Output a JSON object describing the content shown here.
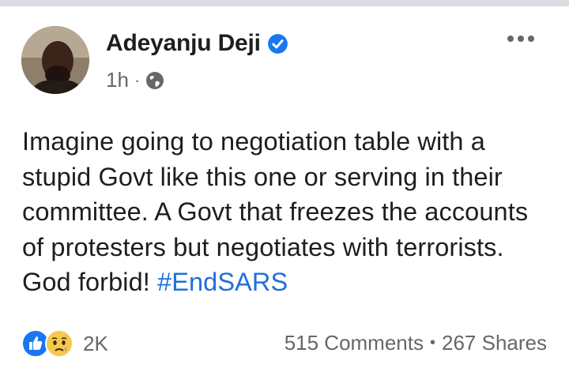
{
  "post": {
    "author": "Adeyanju Deji",
    "time": "1h",
    "separator": "·",
    "privacy_icon": "globe-icon",
    "verified_icon": "verified-badge-icon",
    "more_icon": "more-options-icon",
    "text_main": "Imagine going to negotiation table with a stupid Govt like this one or serving in their committee. A Govt that freezes the accounts of protesters but negotiates with terrorists. God forbid! ",
    "hashtag": "#EndSARS"
  },
  "footer": {
    "reaction_icons": [
      "like-reaction-icon",
      "sad-reaction-icon"
    ],
    "reaction_count": "2K",
    "comments": "515 Comments",
    "dot": "•",
    "shares": "267 Shares"
  },
  "colors": {
    "link": "#216fdb",
    "muted": "#65676b",
    "text": "#1c1e21",
    "verified": "#1877f2"
  }
}
